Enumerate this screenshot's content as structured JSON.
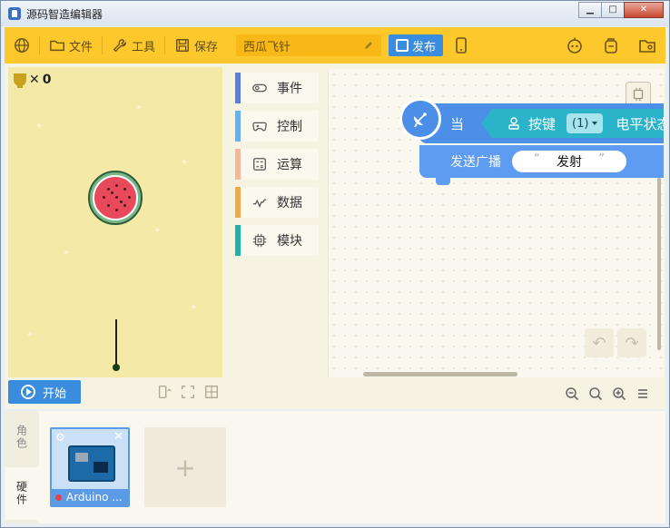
{
  "window": {
    "title": "源码智造编辑器"
  },
  "toolbar": {
    "file": "文件",
    "tools": "工具",
    "save": "保存",
    "project_name": "西瓜飞针",
    "publish": "发布"
  },
  "stage": {
    "score": "0",
    "start": "开始"
  },
  "categories": [
    {
      "label": "事件",
      "color": "#5b7ee5"
    },
    {
      "label": "控制",
      "color": "#64b0f2"
    },
    {
      "label": "运算",
      "color": "#f5b89a"
    },
    {
      "label": "数据",
      "color": "#f2a84e"
    },
    {
      "label": "模块",
      "color": "#20b2aa"
    }
  ],
  "blocks": {
    "when": "当",
    "key": "按键",
    "key_value": "(1)",
    "level": "电平状态",
    "send": "发送广播",
    "message": "发射"
  },
  "bottom": {
    "tab_role": "角色",
    "tab_hardware": "硬件",
    "device_name": "Arduino ...",
    "add": "+"
  }
}
